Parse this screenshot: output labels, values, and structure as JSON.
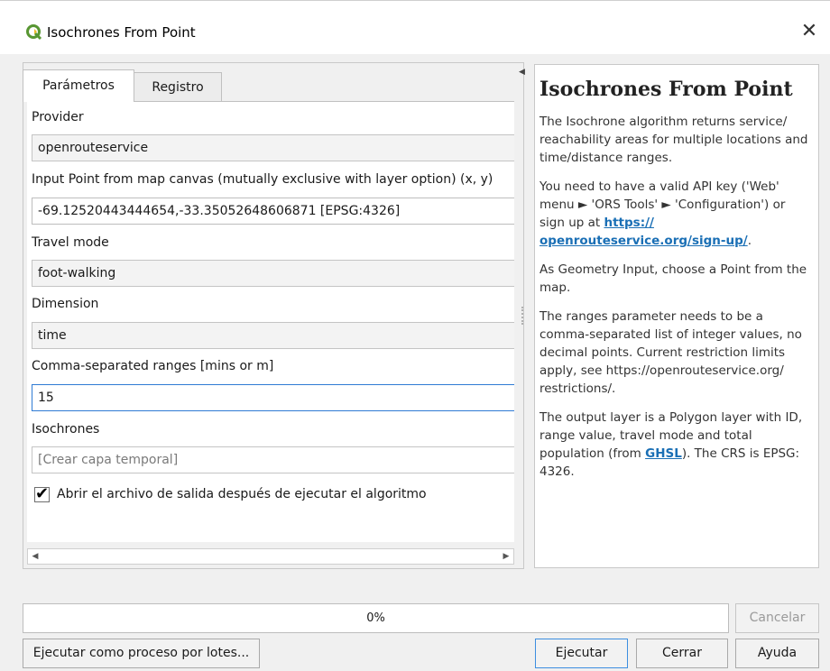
{
  "window": {
    "title": "Isochrones From Point",
    "close_label": "✕"
  },
  "tabs": [
    {
      "label": "Parámetros",
      "active": true
    },
    {
      "label": "Registro",
      "active": false
    }
  ],
  "params": {
    "provider": {
      "label": "Provider",
      "value": "openrouteservice"
    },
    "input_point": {
      "label": "Input Point from map canvas (mutually exclusive with layer option) (x, y)",
      "value": "-69.12520443444654,-33.35052648606871 [EPSG:4326]"
    },
    "travel_mode": {
      "label": "Travel mode",
      "value": "foot-walking"
    },
    "dimension": {
      "label": "Dimension",
      "value": "time"
    },
    "ranges": {
      "label": "Comma-separated ranges [mins or m]",
      "value": "15"
    },
    "isochrones": {
      "label": "Isochrones",
      "placeholder": "[Crear capa temporal]"
    },
    "open_output": {
      "label": "Abrir el archivo de salida después de ejecutar el algoritmo",
      "checked": true,
      "check_glyph": "✔"
    }
  },
  "help": {
    "title": "Isochrones From Point",
    "p1": "The Isochrone algorithm returns service/ reachability areas for multiple locations and time/distance ranges.",
    "p2_prefix": "You need to have a valid API key ('Web' menu ► 'ORS Tools' ► 'Configuration') or sign up at ",
    "p2_link": "https:// openrouteservice.org/sign-up/",
    "p2_suffix": ".",
    "p3": "As Geometry Input, choose a Point from the map.",
    "p4": "The ranges parameter needs to be a comma-separated list of integer values, no decimal points. Current restriction limits apply, see https://openrouteservice.org/ restrictions/.",
    "p5_prefix": "The output layer is a Polygon layer with ID, range value, travel mode and total population (from ",
    "p5_link": "GHSL",
    "p5_suffix": "). The CRS is EPSG: 4326."
  },
  "progress": {
    "label": "0%",
    "value": 0
  },
  "buttons": {
    "cancel": "Cancelar",
    "batch": "Ejecutar como proceso por lotes...",
    "run": "Ejecutar",
    "close": "Cerrar",
    "help": "Ayuda"
  },
  "colors": {
    "accent": "#2f7bd4",
    "link": "#1a6fb5",
    "qgis_green": "#589632",
    "qgis_yellow": "#eebc2c"
  }
}
